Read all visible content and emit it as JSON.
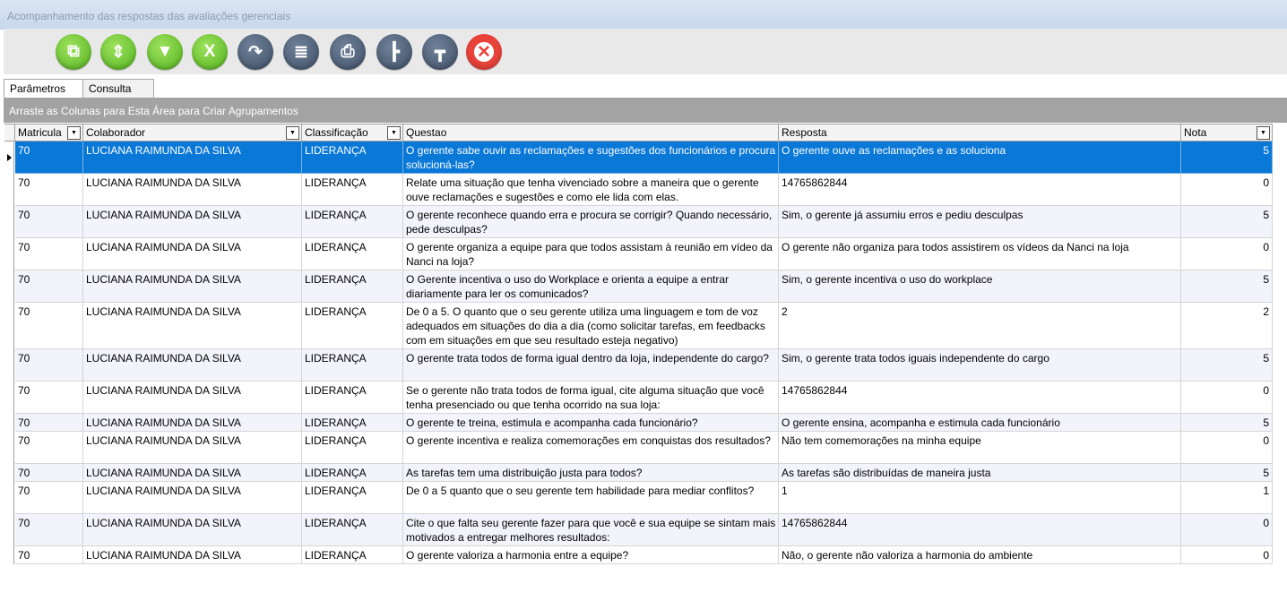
{
  "window": {
    "title": "Acompanhamento das respostas das avaliações gerenciais"
  },
  "toolbar": {
    "buttons": [
      {
        "icon": "new-document-icon",
        "color": "green"
      },
      {
        "icon": "export-document-icon",
        "color": "green"
      },
      {
        "icon": "filter-icon",
        "color": "green"
      },
      {
        "icon": "excel-icon",
        "color": "green"
      },
      {
        "icon": "redo-arrow-icon",
        "color": "navy"
      },
      {
        "icon": "database-icon",
        "color": "navy"
      },
      {
        "icon": "printer-icon",
        "color": "navy"
      },
      {
        "icon": "tree-expand-icon",
        "color": "navy"
      },
      {
        "icon": "tree-collapse-icon",
        "color": "navy"
      },
      {
        "icon": "close-icon",
        "color": "red"
      }
    ]
  },
  "tabs": [
    {
      "label": "Parâmetros"
    },
    {
      "label": "Consulta"
    }
  ],
  "group_panel": {
    "text": "Arraste as Colunas para Esta Área para Criar Agrupamentos"
  },
  "grid": {
    "columns": [
      "Matricula",
      "Colaborador",
      "Classificação",
      "Questao",
      "Resposta",
      "Nota"
    ],
    "rows": [
      [
        "70",
        "LUCIANA RAIMUNDA DA SILVA",
        "LIDERANÇA",
        "O gerente sabe ouvir as reclamações e sugestões dos funcionários e procura solucioná-las?",
        "O gerente ouve as reclamações e as soluciona",
        "5"
      ],
      [
        "70",
        "LUCIANA RAIMUNDA DA SILVA",
        "LIDERANÇA",
        "Relate uma situação que tenha vivenciado sobre a maneira que o gerente ouve reclamações e sugestões e como ele lida com elas.",
        "14765862844",
        "0"
      ],
      [
        "70",
        "LUCIANA RAIMUNDA DA SILVA",
        "LIDERANÇA",
        "O gerente reconhece quando erra e procura se corrigir? Quando necessário, pede desculpas?",
        "Sim, o gerente já assumiu erros e pediu desculpas",
        "5"
      ],
      [
        "70",
        "LUCIANA RAIMUNDA DA SILVA",
        "LIDERANÇA",
        "O gerente organiza a equipe para que todos assistam à reunião em vídeo da Nanci na loja?",
        "O gerente não organiza para todos assistirem os vídeos da Nanci na loja",
        "0"
      ],
      [
        "70",
        "LUCIANA RAIMUNDA DA SILVA",
        "LIDERANÇA",
        "O Gerente incentiva o uso do Workplace e orienta a equipe a entrar diariamente para ler os comunicados?",
        "Sim, o gerente incentiva o uso do workplace",
        "5"
      ],
      [
        "70",
        "LUCIANA RAIMUNDA DA SILVA",
        "LIDERANÇA",
        "De 0 a 5. O quanto que o seu gerente utiliza uma linguagem e tom de voz adequados em situações do dia a dia (como solicitar tarefas, em feedbacks com em situações em que seu resultado esteja negativo)",
        "2",
        "2"
      ],
      [
        "70",
        "LUCIANA RAIMUNDA DA SILVA",
        "LIDERANÇA",
        "O gerente trata todos de forma igual dentro da loja, independente do cargo?",
        "Sim, o gerente trata todos iguais independente do cargo",
        "5"
      ],
      [
        "70",
        "LUCIANA RAIMUNDA DA SILVA",
        "LIDERANÇA",
        "Se o gerente não trata todos de forma igual, cite alguma situação que você tenha presenciado ou que tenha ocorrido na sua loja:",
        "14765862844",
        "0"
      ],
      [
        "70",
        "LUCIANA RAIMUNDA DA SILVA",
        "LIDERANÇA",
        "O gerente te treina, estimula e acompanha cada funcionário?",
        "O gerente ensina, acompanha e estimula cada funcionário",
        "5"
      ],
      [
        "70",
        "LUCIANA RAIMUNDA DA SILVA",
        "LIDERANÇA",
        "O gerente incentiva e realiza comemorações em conquistas dos resultados?",
        "Não tem comemorações na minha equipe",
        "0"
      ],
      [
        "70",
        "LUCIANA RAIMUNDA DA SILVA",
        "LIDERANÇA",
        "As tarefas tem uma distribuição justa para todos?",
        "As tarefas são distribuídas de maneira justa",
        "5"
      ],
      [
        "70",
        "LUCIANA RAIMUNDA DA SILVA",
        "LIDERANÇA",
        "De 0 a 5 quanto que o seu gerente tem habilidade para mediar conflitos?",
        "1",
        "1"
      ],
      [
        "70",
        "LUCIANA RAIMUNDA DA SILVA",
        "LIDERANÇA",
        "Cite o que falta seu gerente fazer para que você e sua equipe se sintam mais motivados a entregar melhores resultados:",
        "14765862844",
        "0"
      ],
      [
        "70",
        "LUCIANA RAIMUNDA DA SILVA",
        "LIDERANÇA",
        "O gerente valoriza a harmonia entre a equipe?",
        "Não, o gerente não valoriza a harmonia do ambiente",
        "0"
      ]
    ],
    "selected_row": 0
  }
}
